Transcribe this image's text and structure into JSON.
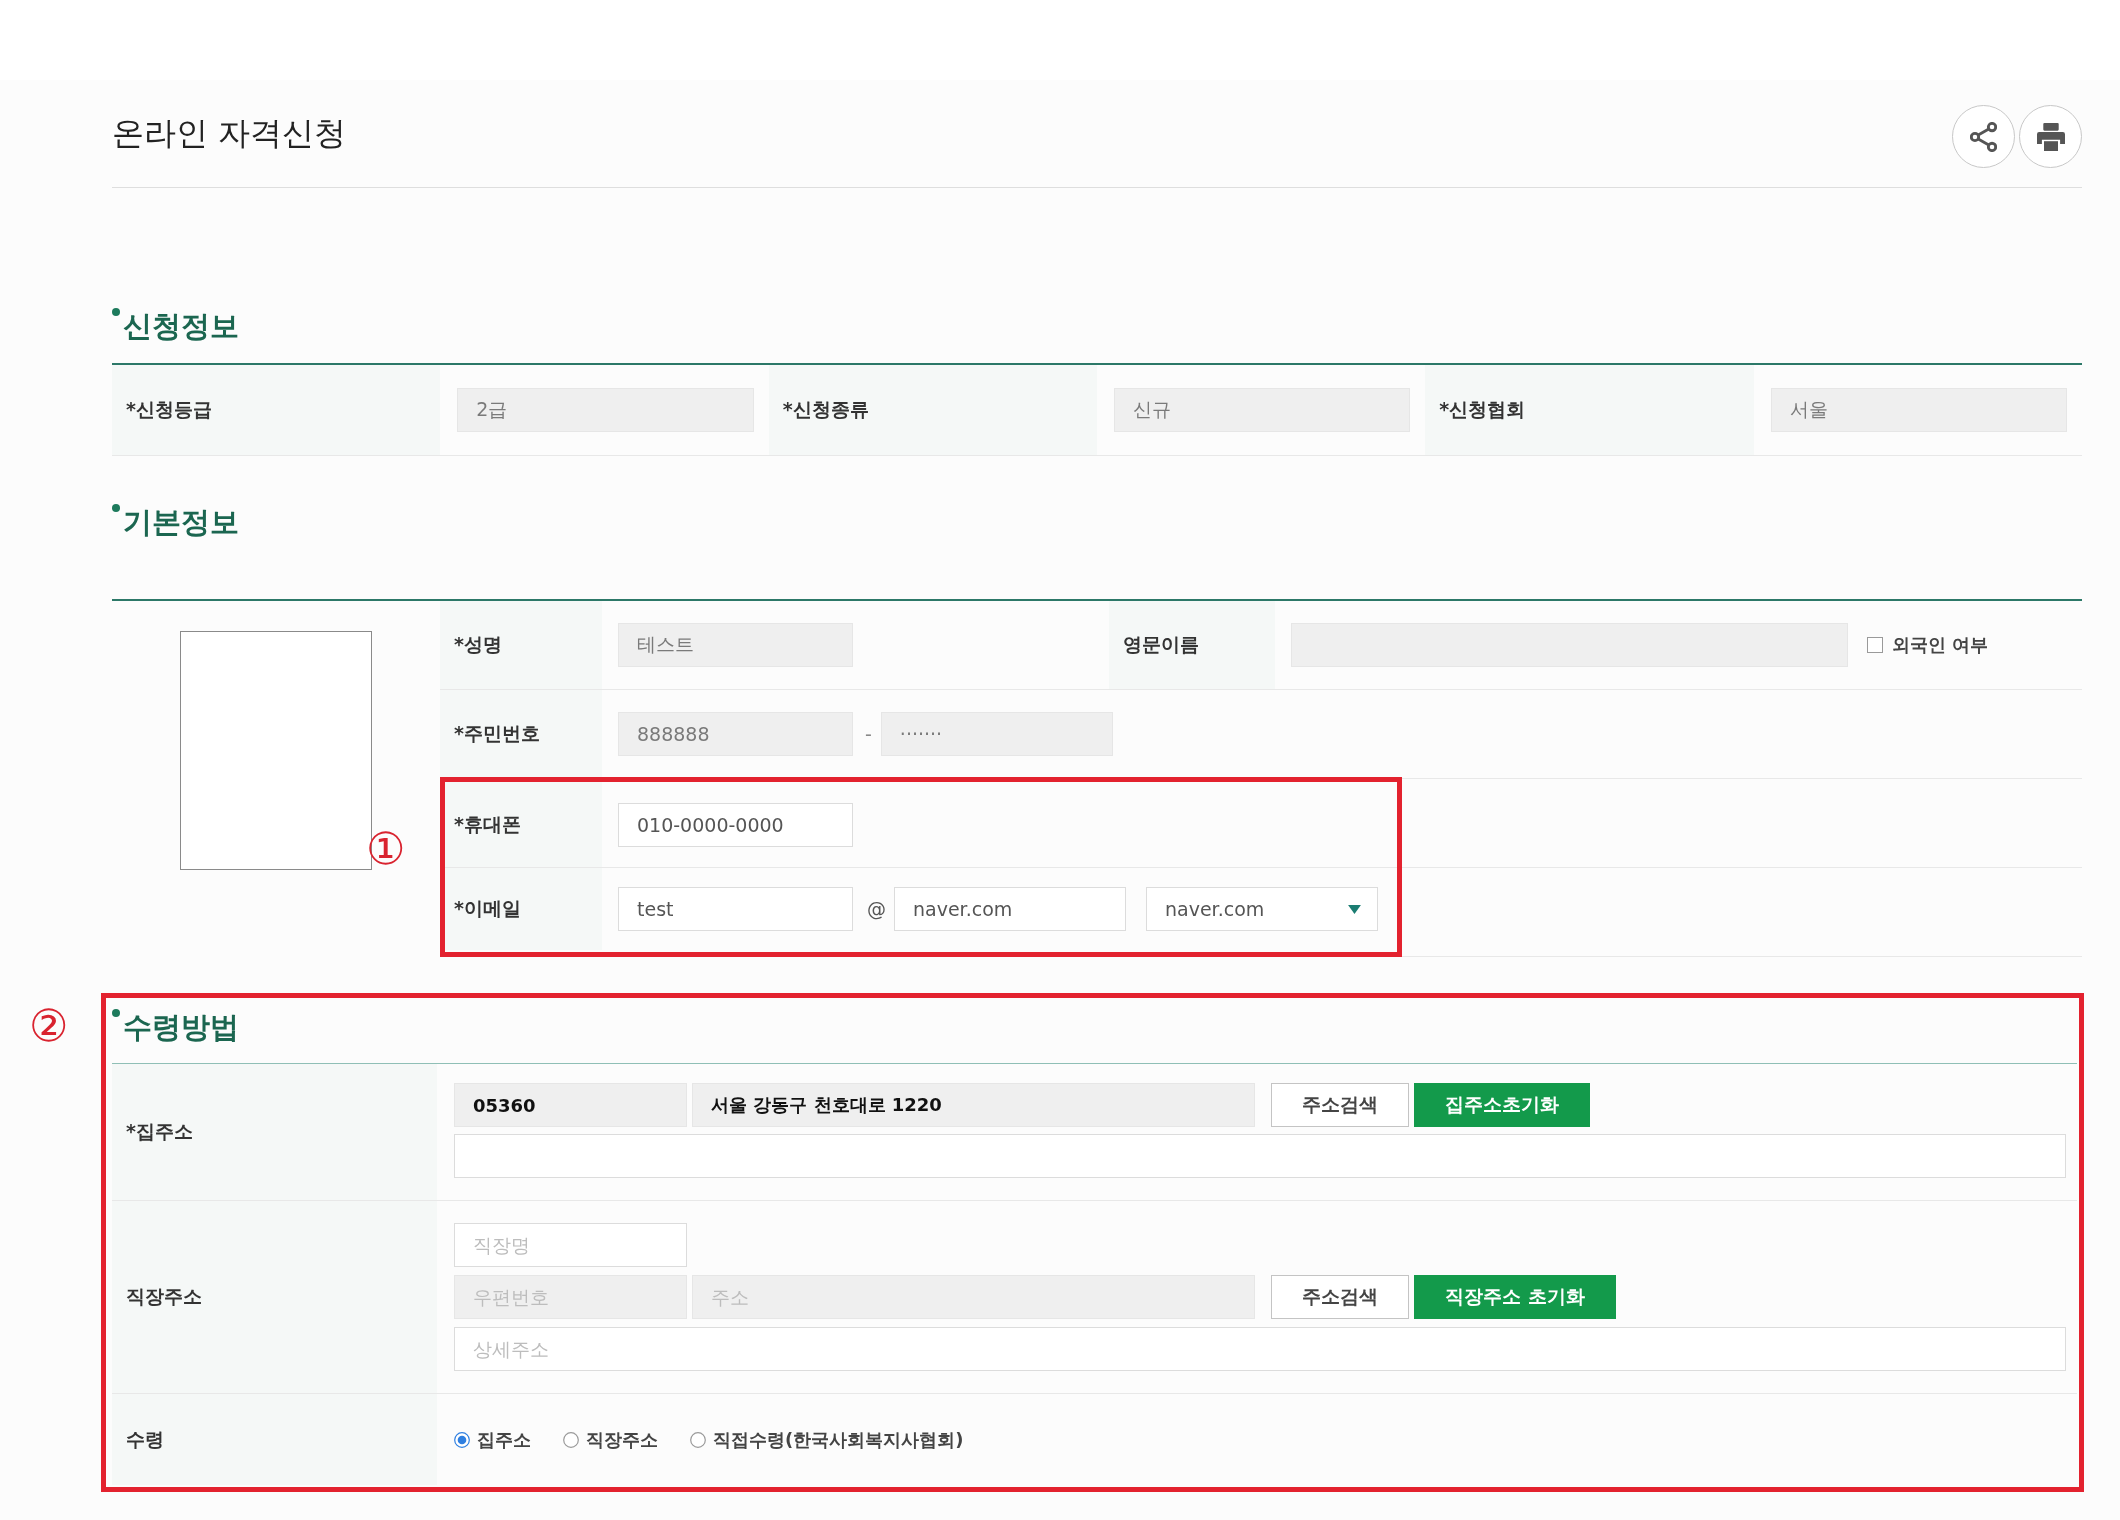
{
  "page": {
    "title": "온라인 자격신청"
  },
  "application_info": {
    "heading": "신청정보",
    "fields": [
      {
        "label": "*신청등급",
        "value": "2급"
      },
      {
        "label": "*신청종류",
        "value": "신규"
      },
      {
        "label": "*신청협회",
        "value": "서울"
      }
    ]
  },
  "basic_info": {
    "heading": "기본정보",
    "name": {
      "label": "*성명",
      "value": "테스트"
    },
    "english_name": {
      "label": "영문이름"
    },
    "foreigner": {
      "label": "외국인 여부",
      "checked": false
    },
    "resident_number": {
      "label": "*주민번호",
      "first": "888888",
      "separator": "-",
      "second": "·······"
    },
    "mobile": {
      "label": "*휴대폰",
      "value": "010-0000-0000"
    },
    "email": {
      "label": "*이메일",
      "local_part": "test",
      "at": "@",
      "domain": "naver.com",
      "domain_select": "naver.com"
    },
    "annotation": "①"
  },
  "receipt_method": {
    "heading": "수령방법",
    "annotation": "②",
    "home_address": {
      "label": "*집주소",
      "zip": "05360",
      "address": "서울 강동구 천호대로 1220",
      "search_button": "주소검색",
      "reset_button": "집주소초기화"
    },
    "work_address": {
      "label": "직장주소",
      "workplace_placeholder": "직장명",
      "zip_placeholder": "우편번호",
      "address_placeholder": "주소",
      "search_button": "주소검색",
      "reset_button": "직장주소 초기화",
      "detail_placeholder": "상세주소"
    },
    "receipt": {
      "label": "수령",
      "options": [
        {
          "label": "집주소",
          "selected": true
        },
        {
          "label": "직장주소",
          "selected": false
        },
        {
          "label": "직접수령(한국사회복지사협회)",
          "selected": false
        }
      ]
    }
  }
}
